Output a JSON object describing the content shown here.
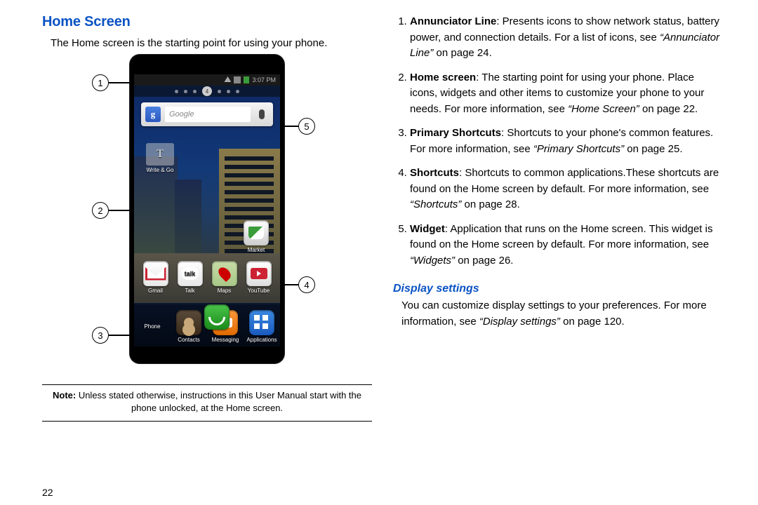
{
  "page_number": "22",
  "left": {
    "heading": "Home Screen",
    "intro": "The Home screen is the starting point for using your phone.",
    "note_label": "Note:",
    "note_text": " Unless stated otherwise, instructions in this User Manual start with the phone unlocked, at the Home screen."
  },
  "phone": {
    "time": "3:07 PM",
    "pager_current": "4",
    "search_brand": "g",
    "search_placeholder": "Google",
    "writego_brand": "T",
    "writego_label": "Write & Go",
    "mid_icons": [
      {
        "label": "Market",
        "cls": "market"
      }
    ],
    "app_row": [
      {
        "label": "Gmail",
        "cls": "gmail"
      },
      {
        "label": "Talk",
        "cls": "talk"
      },
      {
        "label": "Maps",
        "cls": "maps"
      },
      {
        "label": "YouTube",
        "cls": "yt"
      }
    ],
    "dock": [
      {
        "label": "Phone",
        "cls": "phone"
      },
      {
        "label": "Contacts",
        "cls": "contacts"
      },
      {
        "label": "Messaging",
        "cls": "msg"
      },
      {
        "label": "Applications",
        "cls": "appsgrid"
      }
    ],
    "callouts": {
      "c1": "1",
      "c2": "2",
      "c3": "3",
      "c4": "4",
      "c5": "5"
    }
  },
  "right": {
    "items": [
      {
        "term": "Annunciator Line",
        "after_term": ": Presents icons to show network status, battery power, and connection details. For a list of icons, see ",
        "ref": "“Annunciator Line”",
        "tail": " on page 24."
      },
      {
        "term": "Home screen",
        "after_term": ": The starting point for using your phone. Place icons, widgets and other items to customize your phone to your needs. For more information, see ",
        "ref": "“Home Screen”",
        "tail": " on page 22."
      },
      {
        "term": "Primary Shortcuts",
        "after_term": ": Shortcuts to your phone's common features. For more information, see ",
        "ref": "“Primary Shortcuts”",
        "tail": " on page 25."
      },
      {
        "term": "Shortcuts",
        "after_term": ": Shortcuts to common applications.These shortcuts are found on the Home screen by default. For more information, see ",
        "ref": "“Shortcuts”",
        "tail": " on page 28."
      },
      {
        "term": "Widget",
        "after_term": ": Application that runs on the Home screen. This widget is found on the Home screen by default. For more information, see ",
        "ref": "“Widgets”",
        "tail": " on page 26."
      }
    ],
    "sub_heading": "Display settings",
    "sub_text_a": "You can customize display settings to your preferences. For more information, see ",
    "sub_ref": "“Display settings”",
    "sub_text_b": " on page 120."
  }
}
